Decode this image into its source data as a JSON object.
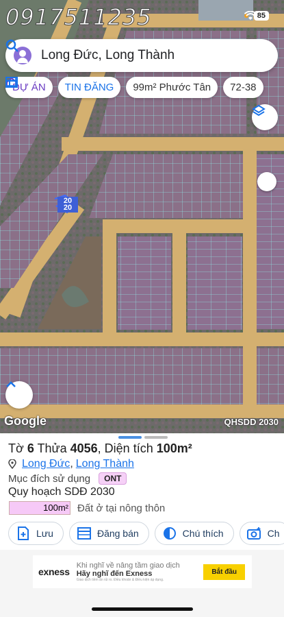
{
  "status": {
    "phone_watermark": "0917511235",
    "battery": "85"
  },
  "search": {
    "query": "Long Đức, Long Thành"
  },
  "chips": [
    {
      "label": "DỰ ÁN",
      "icon": "house-icon"
    },
    {
      "label": "TIN ĐĂNG",
      "icon": "listing-icon"
    },
    {
      "label": "99m² Phước Tân",
      "icon": "listing-icon"
    },
    {
      "label": "72-38"
    }
  ],
  "map": {
    "google": "Google",
    "layer_label": "QHSDD 2030",
    "lot_numbers": [
      "20",
      "20"
    ]
  },
  "info": {
    "to_label": "Tờ",
    "to_value": "6",
    "thua_label": "Thửa",
    "thua_value": "4056",
    "area_label": ", Diện tích",
    "area_value": "100m²",
    "location_parts": [
      "Long Đức",
      "Long Thành"
    ],
    "purpose_label": "Mục đích sử dụng",
    "purpose_code": "ONT",
    "plan": "Quy hoạch SDĐ 2030",
    "area_chip": "100m²",
    "area_desc": "Đất ở tại nông thôn"
  },
  "actions": [
    {
      "label": "Lưu",
      "icon": "save-icon"
    },
    {
      "label": "Đăng bán",
      "icon": "post-icon"
    },
    {
      "label": "Chú thích",
      "icon": "legend-icon"
    },
    {
      "label": "Ch",
      "icon": "camera-icon"
    }
  ],
  "ad": {
    "brand": "exness",
    "line1": "Khi nghĩ về nâng tầm giao dịch",
    "line2": "Hãy nghĩ đến Exness",
    "line3": "Giao dịch tiềm ẩn rủi ro. Điều khoản & Điều kiện áp dụng.",
    "cta": "Bắt đầu"
  },
  "colors": {
    "accent": "#1a73e8",
    "purple": "#6a3bc2",
    "badge": "#f6d1f7",
    "road": "#d4b070",
    "lot_fill": "#8a6f86"
  }
}
